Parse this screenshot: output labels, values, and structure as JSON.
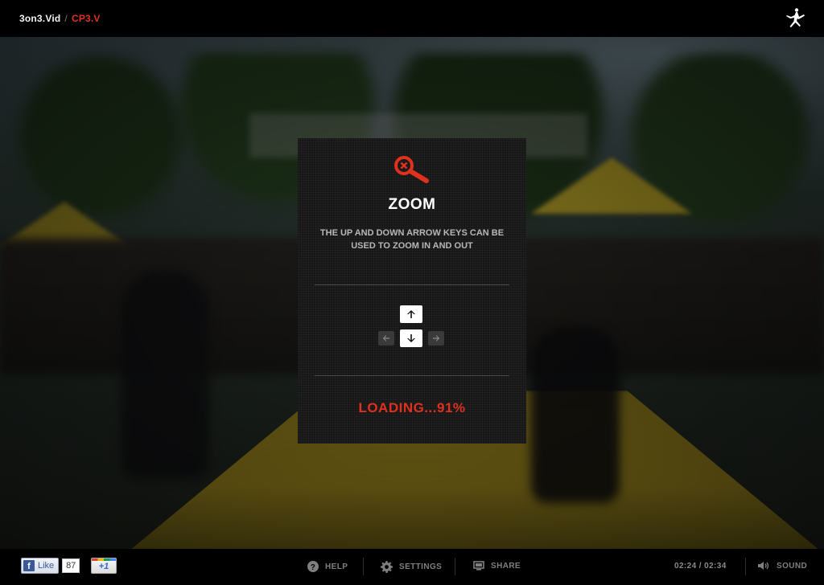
{
  "breadcrumb": {
    "root": "3on3.Vid",
    "separator": "/",
    "current": "CP3.V"
  },
  "brand": {
    "logo_icon": "jumpman-logo-icon"
  },
  "overlay": {
    "icon": "zoom-magnifier-icon",
    "title": "ZOOM",
    "description": "THE UP AND DOWN ARROW KEYS CAN BE USED TO ZOOM IN AND OUT",
    "keys": {
      "up": "arrow-up-icon",
      "down": "arrow-down-icon",
      "left": "arrow-left-icon",
      "right": "arrow-right-icon"
    },
    "loading_text": "LOADING...91%",
    "loading_progress_percent": 91
  },
  "social": {
    "facebook": {
      "label": "Like",
      "count": "87"
    },
    "google": {
      "label": "+1"
    }
  },
  "controls": {
    "help": "HELP",
    "settings": "SETTINGS",
    "share": "SHARE",
    "time": "02:24 / 02:34",
    "sound": "SOUND"
  },
  "colors": {
    "accent": "#e0301e",
    "background": "#000000",
    "panel": "#161616"
  }
}
